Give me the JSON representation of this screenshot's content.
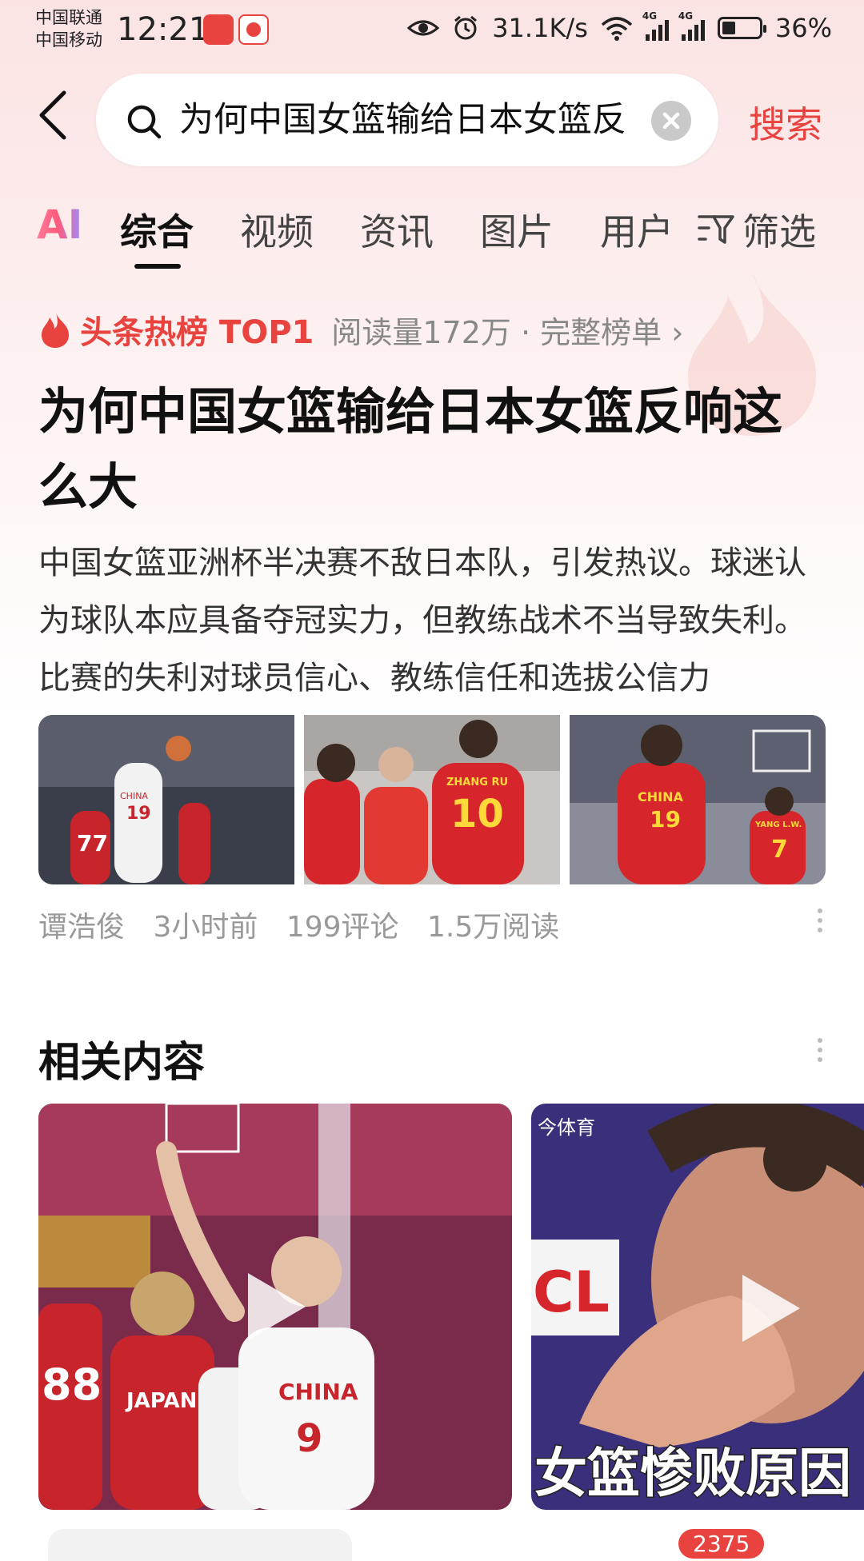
{
  "status_bar": {
    "carrier_1": "中国联通",
    "carrier_2": "中国移动",
    "time": "12:21",
    "net_speed": "31.1K/s",
    "battery": "36%",
    "battery_level": 0.36,
    "signal_label": "4G"
  },
  "search": {
    "query": "为何中国女篮输给日本女篮反响这么大",
    "submit_label": "搜索"
  },
  "tabs": {
    "ai": "AI",
    "items": [
      "综合",
      "视频",
      "资讯",
      "图片",
      "用户"
    ],
    "active": "综合",
    "filter": "筛选"
  },
  "hot": {
    "title": "头条热榜 TOP1",
    "meta": "阅读量172万 · 完整榜单 ›"
  },
  "article": {
    "headline": "为何中国女篮输给日本女篮反响这么大",
    "summary": "中国女篮亚洲杯半决赛不敌日本队，引发热议。球迷认为球队本应具备夺冠实力，但教练战术不当导致失利。比赛的失利对球员信心、教练信任和选拔公信力",
    "author": "谭浩俊",
    "time": "3小时前",
    "comments": "199评论",
    "reads": "1.5万阅读",
    "images": [
      {
        "jersey_1": "77",
        "jersey_2": "19",
        "text": "CHINA"
      },
      {
        "jersey": "10",
        "name": "ZHANG RU"
      },
      {
        "jersey": "19",
        "text": "CHINA",
        "jersey_2": "7",
        "name_2": "YANG L.W."
      }
    ]
  },
  "related": {
    "title": "相关内容",
    "videos": [
      {
        "jersey_1": "88",
        "text_1": "JAPAN",
        "text_2": "CHINA",
        "jersey_2": "9"
      },
      {
        "source": "今体育",
        "caption": "女篮惨败原因"
      }
    ]
  },
  "bottom": {
    "count": "2375"
  },
  "colors": {
    "accent": "#e8433f",
    "bg_top": "#fbe3e3"
  }
}
